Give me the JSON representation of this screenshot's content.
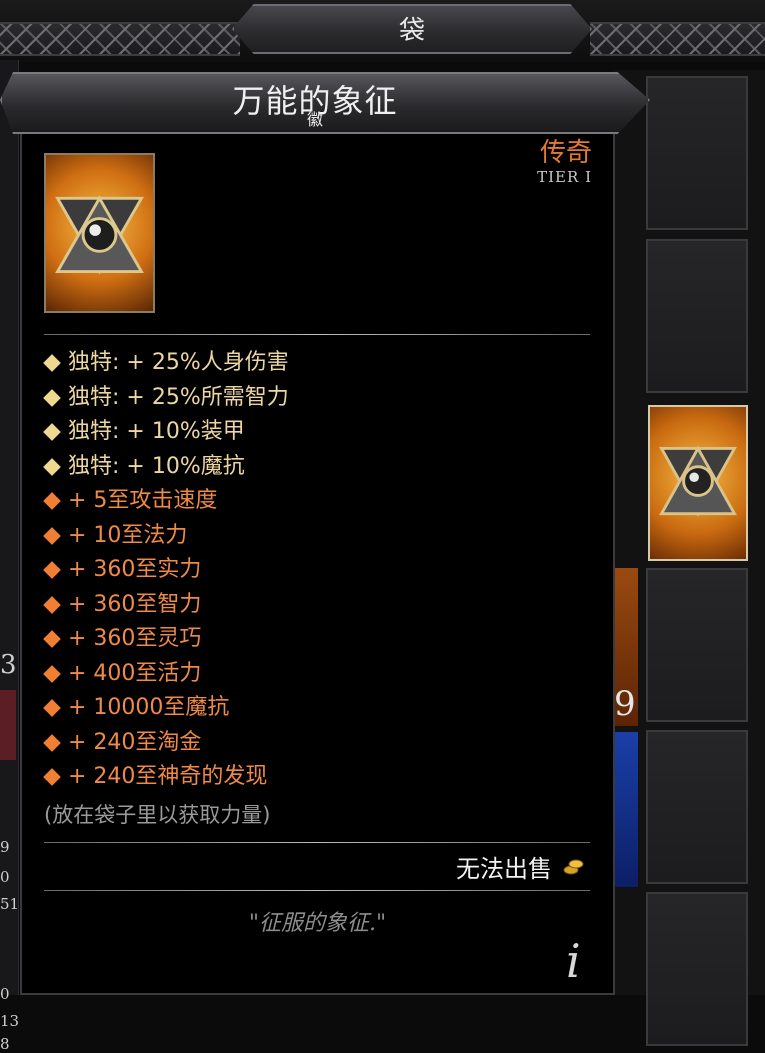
{
  "header": {
    "bag_title": "袋"
  },
  "item": {
    "title": "万能的象征",
    "subtitle": "徽",
    "rarity": "传奇",
    "tier": "TIER I",
    "properties": [
      {
        "kind": "unique",
        "text": "独特: + 25%人身伤害"
      },
      {
        "kind": "unique",
        "text": "独特: + 25%所需智力"
      },
      {
        "kind": "unique",
        "text": "独特: + 10%装甲"
      },
      {
        "kind": "unique",
        "text": "独特: + 10%魔抗"
      },
      {
        "kind": "normal",
        "text": "+ 5至攻击速度"
      },
      {
        "kind": "normal",
        "text": "+ 10至法力"
      },
      {
        "kind": "normal",
        "text": "+ 360至实力"
      },
      {
        "kind": "normal",
        "text": "+ 360至智力"
      },
      {
        "kind": "normal",
        "text": "+ 360至灵巧"
      },
      {
        "kind": "normal",
        "text": "+ 400至活力"
      },
      {
        "kind": "normal",
        "text": "+ 10000至魔抗"
      },
      {
        "kind": "normal",
        "text": "+ 240至淘金"
      },
      {
        "kind": "normal",
        "text": "+ 240至神奇的发现"
      }
    ],
    "hint": "(放在袋子里以获取力量)",
    "sell_status": "无法出售",
    "flavor_text": "\"征服的象征.\"",
    "info_glyph": "i"
  },
  "background": {
    "inventory_stack_count": "9",
    "left_numbers": [
      "3",
      "9",
      "0",
      "51",
      "0",
      "13",
      "8"
    ]
  },
  "colors": {
    "rarity": "#e37a31",
    "unique_property": "#ecd6a1",
    "normal_property": "#ef8a47",
    "hint": "#9a9a9a"
  }
}
